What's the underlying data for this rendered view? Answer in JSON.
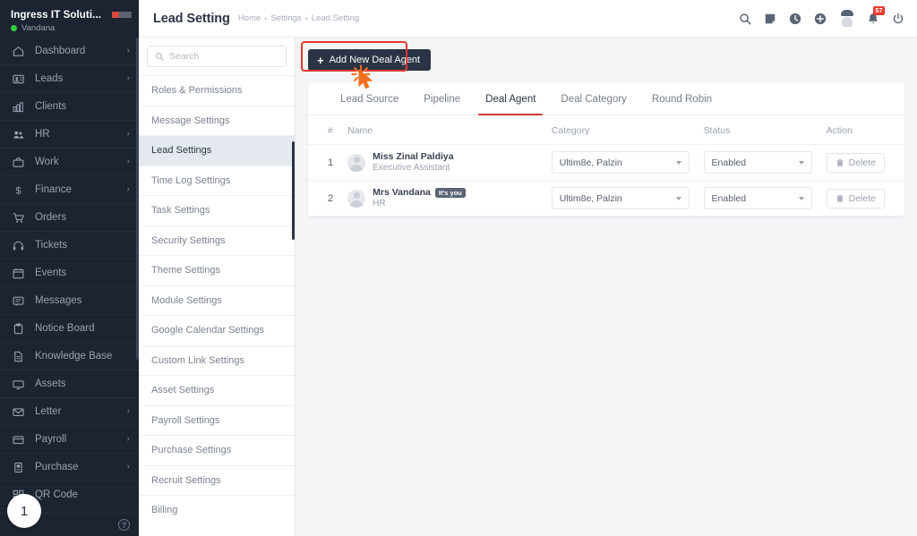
{
  "sidebar": {
    "brand_title": "Ingress IT Soluti...",
    "username": "Vandana",
    "items": [
      {
        "label": "Dashboard",
        "icon": "home-icon",
        "arrow": "›"
      },
      {
        "label": "Leads",
        "icon": "leads-icon",
        "arrow": "›"
      },
      {
        "label": "Clients",
        "icon": "clients-icon",
        "arrow": ""
      },
      {
        "label": "HR",
        "icon": "hr-icon",
        "arrow": "›"
      },
      {
        "label": "Work",
        "icon": "briefcase-icon",
        "arrow": "›"
      },
      {
        "label": "Finance",
        "icon": "dollar-icon",
        "arrow": "›"
      },
      {
        "label": "Orders",
        "icon": "cart-icon",
        "arrow": ""
      },
      {
        "label": "Tickets",
        "icon": "headset-icon",
        "arrow": ""
      },
      {
        "label": "Events",
        "icon": "calendar-icon",
        "arrow": ""
      },
      {
        "label": "Messages",
        "icon": "message-icon",
        "arrow": ""
      },
      {
        "label": "Notice Board",
        "icon": "clipboard-icon",
        "arrow": ""
      },
      {
        "label": "Knowledge Base",
        "icon": "document-icon",
        "arrow": ""
      },
      {
        "label": "Assets",
        "icon": "monitor-icon",
        "arrow": ""
      },
      {
        "label": "Letter",
        "icon": "envelope-icon",
        "arrow": "›"
      },
      {
        "label": "Payroll",
        "icon": "wallet-icon",
        "arrow": "›"
      },
      {
        "label": "Purchase",
        "icon": "purchase-icon",
        "arrow": "›"
      },
      {
        "label": "QR Code",
        "icon": "qr-icon",
        "arrow": ""
      }
    ]
  },
  "topbar": {
    "title": "Lead Setting",
    "breadcrumbs": [
      "Home",
      "Settings",
      "Lead Setting"
    ],
    "separator": "•",
    "icons": [
      {
        "name": "search-icon"
      },
      {
        "name": "note-icon"
      },
      {
        "name": "clock-icon"
      },
      {
        "name": "plus-circle-icon"
      }
    ],
    "notification_count": "57"
  },
  "settings": {
    "search_placeholder": "Search",
    "search_value": "",
    "items": [
      {
        "label": "Roles & Permissions",
        "active": false
      },
      {
        "label": "Message Settings",
        "active": false
      },
      {
        "label": "Lead Settings",
        "active": true
      },
      {
        "label": "Time Log Settings",
        "active": false
      },
      {
        "label": "Task Settings",
        "active": false
      },
      {
        "label": "Security Settings",
        "active": false
      },
      {
        "label": "Theme Settings",
        "active": false
      },
      {
        "label": "Module Settings",
        "active": false
      },
      {
        "label": "Google Calendar Settings",
        "active": false
      },
      {
        "label": "Custom Link Settings",
        "active": false
      },
      {
        "label": "Asset Settings",
        "active": false
      },
      {
        "label": "Payroll Settings",
        "active": false
      },
      {
        "label": "Purchase Settings",
        "active": false
      },
      {
        "label": "Recruit Settings",
        "active": false
      },
      {
        "label": "Billing",
        "active": false
      }
    ]
  },
  "main": {
    "add_button_label": "Add New Deal Agent",
    "add_button_plus": "+",
    "tabs": [
      {
        "label": "Lead Source",
        "active": false
      },
      {
        "label": "Pipeline",
        "active": false
      },
      {
        "label": "Deal Agent",
        "active": true
      },
      {
        "label": "Deal Category",
        "active": false
      },
      {
        "label": "Round Robin",
        "active": false
      }
    ],
    "table": {
      "headers": [
        "#",
        "Name",
        "Category",
        "Status",
        "Action"
      ],
      "rows": [
        {
          "num": "1",
          "name": "Miss Zinal Paldiya",
          "role": "Executive Assistant",
          "its_you": "",
          "category": "Ultim8e, Palzin",
          "status": "Enabled",
          "action": "Delete"
        },
        {
          "num": "2",
          "name": "Mrs Vandana",
          "role": "HR",
          "its_you": "It's you",
          "category": "Ultim8e, Palzin",
          "status": "Enabled",
          "action": "Delete"
        }
      ]
    }
  },
  "overlay": {
    "step_number": "1"
  },
  "colors": {
    "sidebar_bg": "#1c2331",
    "accent_red": "#cc3b33",
    "highlight_red": "#e03a2f",
    "cursor_orange": "#f2701f",
    "badge_red": "#e8392e",
    "online_green": "#2ecc40"
  }
}
